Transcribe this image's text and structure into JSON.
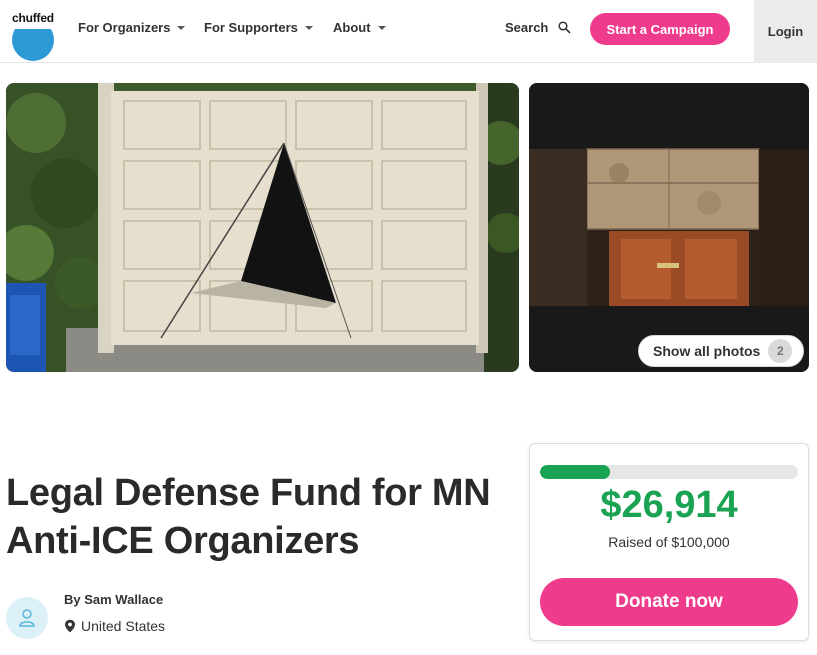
{
  "header": {
    "logo_text": "chuffed",
    "nav": [
      {
        "label": "For Organizers"
      },
      {
        "label": "For Supporters"
      },
      {
        "label": "About"
      }
    ],
    "search_label": "Search",
    "start_campaign_label": "Start a Campaign",
    "login_label": "Login"
  },
  "gallery": {
    "show_all_label": "Show all photos",
    "photo_count": "2"
  },
  "campaign": {
    "title": "Legal Defense Fund for MN Anti-ICE Organizers",
    "organizer_line": "By Sam Wallace",
    "location": "United States"
  },
  "donation": {
    "raised": "$26,914",
    "goal_text": "Raised of $100,000",
    "progress_fraction": 0.27,
    "donate_label": "Donate now"
  },
  "colors": {
    "accent_pink": "#ef3b8c",
    "progress_green": "#1aa352",
    "logo_blue": "#2d9ad6"
  },
  "icons": [
    "search-icon",
    "caret-down-icon",
    "location-pin-icon",
    "user-icon"
  ]
}
